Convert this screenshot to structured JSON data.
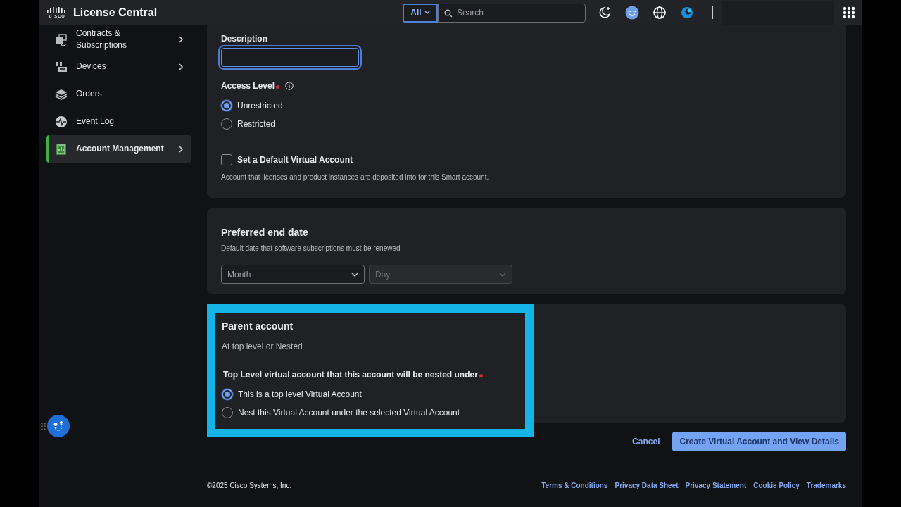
{
  "header": {
    "logo_text": "cisco",
    "title": "License Central",
    "search_scope": "All",
    "search": {
      "placeholder": "Search"
    }
  },
  "sidebar": {
    "items": [
      {
        "label": "Contracts & Subscriptions",
        "has_submenu": true,
        "selected": false
      },
      {
        "label": "Devices",
        "has_submenu": true,
        "selected": false
      },
      {
        "label": "Orders",
        "has_submenu": false,
        "selected": false
      },
      {
        "label": "Event Log",
        "has_submenu": false,
        "selected": false
      },
      {
        "label": "Account Management",
        "has_submenu": true,
        "selected": true
      }
    ]
  },
  "form": {
    "description": {
      "label": "Description",
      "focused": true
    },
    "access_level": {
      "label": "Access Level",
      "required": true,
      "options": [
        {
          "label": "Unrestricted",
          "selected": true
        },
        {
          "label": "Restricted",
          "selected": false
        }
      ]
    },
    "default_account": {
      "label": "Set a Default Virtual Account",
      "checked": false,
      "help": "Account that licenses and product instances are deposited into for this Smart account."
    }
  },
  "end_date": {
    "title": "Preferred end date",
    "subtitle": "Default date that software subscriptions must be renewed",
    "selects": [
      {
        "placeholder": "Month",
        "disabled": false
      },
      {
        "placeholder": "Day",
        "disabled": true
      }
    ]
  },
  "parent_account": {
    "title": "Parent account",
    "subtitle": "At top level or Nested",
    "highlighted": true,
    "question": "Top Level virtual account that this account will be nested under",
    "required": true,
    "options": [
      {
        "label": "This is a top level Virtual Account",
        "selected": true
      },
      {
        "label": "Nest this Virtual Account under the selected Virtual Account",
        "selected": false
      }
    ]
  },
  "actions": [
    {
      "label": "Cancel",
      "kind": "link"
    },
    {
      "label": "Create Virtual Account and View Details",
      "kind": "primary"
    }
  ],
  "footer": {
    "copyright": "©2025 Cisco Systems, Inc.",
    "links": [
      "Terms & Conditions",
      "Privacy Data Sheet",
      "Privacy Statement",
      "Cookie Policy",
      "Trademarks"
    ]
  }
}
